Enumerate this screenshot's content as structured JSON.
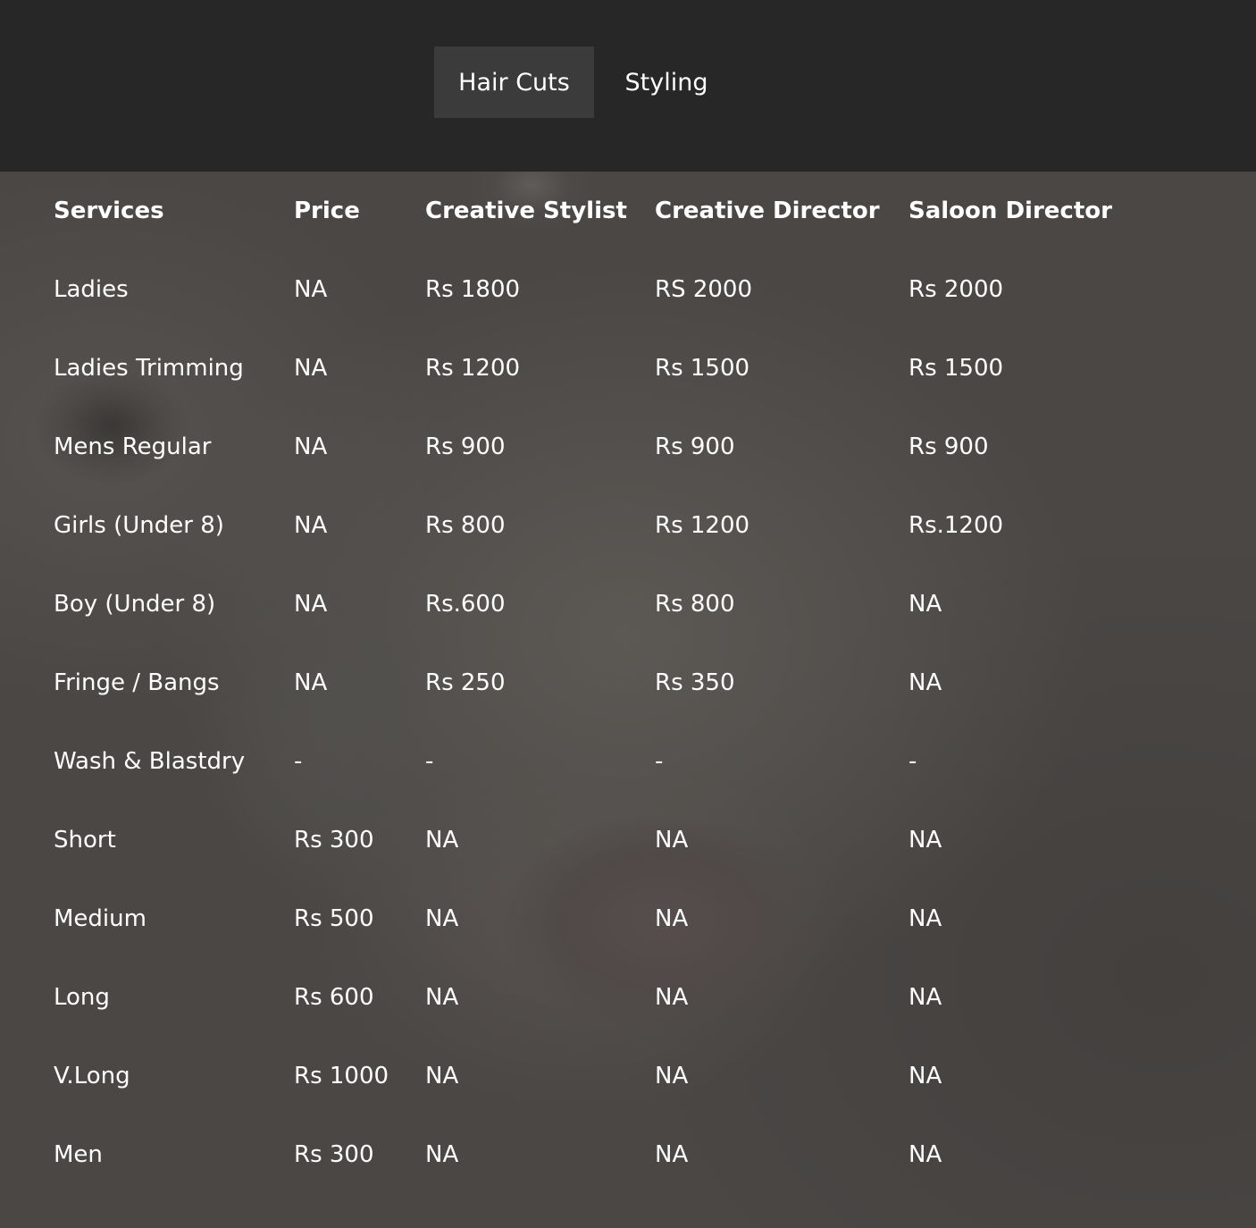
{
  "tabs": [
    {
      "label": "Hair Cuts",
      "active": true
    },
    {
      "label": "Styling",
      "active": false
    }
  ],
  "table": {
    "headers": [
      "Services",
      "Price",
      "Creative Stylist",
      "Creative Director",
      "Saloon Director"
    ],
    "rows": [
      [
        "Ladies",
        "NA",
        "Rs 1800",
        "RS 2000",
        "Rs 2000"
      ],
      [
        "Ladies Trimming",
        "NA",
        "Rs 1200",
        "Rs 1500",
        "Rs 1500"
      ],
      [
        "Mens Regular",
        "NA",
        "Rs 900",
        "Rs 900",
        "Rs 900"
      ],
      [
        "Girls (Under 8)",
        "NA",
        "Rs 800",
        "Rs 1200",
        "Rs.1200"
      ],
      [
        "Boy (Under 8)",
        "NA",
        "Rs.600",
        "Rs 800",
        "NA"
      ],
      [
        "Fringe / Bangs",
        "NA",
        "Rs 250",
        "Rs 350",
        "NA"
      ],
      [
        "Wash & Blastdry",
        "-",
        "-",
        "-",
        "-"
      ],
      [
        "Short",
        "Rs 300",
        "NA",
        "NA",
        "NA"
      ],
      [
        "Medium",
        "Rs 500",
        "NA",
        "NA",
        "NA"
      ],
      [
        "Long",
        "Rs 600",
        "NA",
        "NA",
        "NA"
      ],
      [
        "V.Long",
        "Rs 1000",
        "NA",
        "NA",
        "NA"
      ],
      [
        "Men",
        "Rs 300",
        "NA",
        "NA",
        "NA"
      ]
    ]
  },
  "colors": {
    "topbar": "#272727",
    "active_tab": "#3b3b3b",
    "text": "#ffffff"
  }
}
